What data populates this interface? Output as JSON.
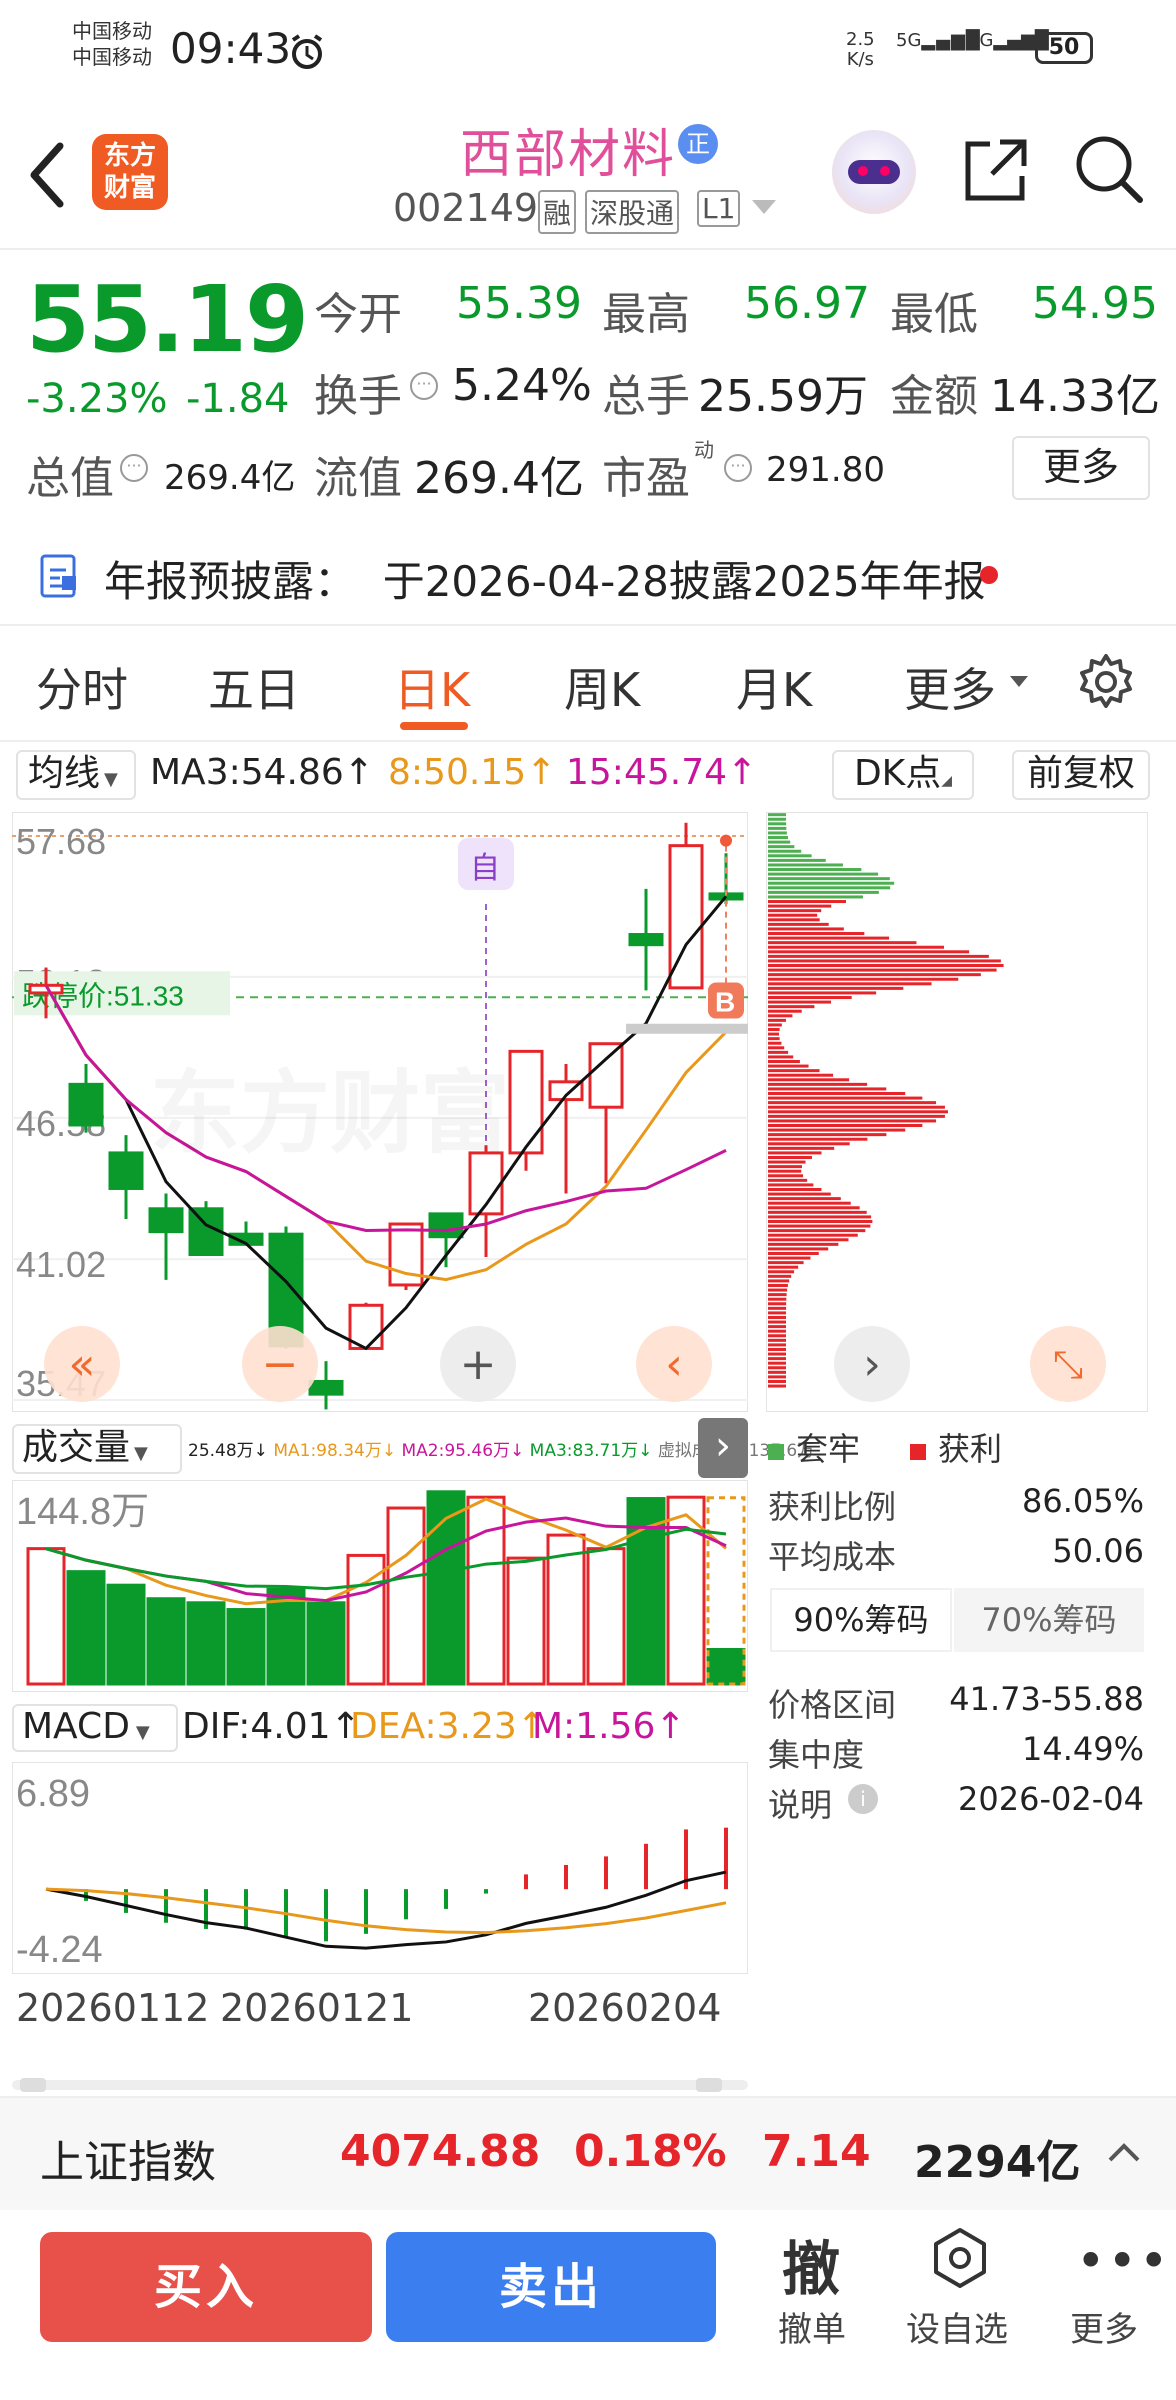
{
  "status_bar": {
    "carrier1": "中国移动",
    "carrier2": "中国移动",
    "time": "09:43",
    "net_speed_top": "2.5",
    "net_speed_bottom": "K/s",
    "sig1": "5G",
    "sig2": "4G",
    "battery": "50"
  },
  "header": {
    "logo_line1": "东方",
    "logo_line2": "财富",
    "stock_name": "西部材料",
    "badge": "正",
    "code": "002149",
    "tags": [
      "融",
      "深股通",
      "L1"
    ]
  },
  "quote": {
    "price": "55.19",
    "change_pct": "-3.23%",
    "change_amt": "-1.84",
    "row1": [
      {
        "label": "今开",
        "value": "55.39"
      },
      {
        "label": "最高",
        "value": "56.97"
      },
      {
        "label": "最低",
        "value": "54.95"
      }
    ],
    "row2": [
      {
        "label": "换手",
        "value": "5.24%"
      },
      {
        "label": "总手",
        "value": "25.59万"
      },
      {
        "label": "金额",
        "value": "14.33亿"
      }
    ],
    "total_value_label": "总值",
    "total_value": "269.4亿",
    "float_label": "流值",
    "float_value": "269.4亿",
    "pe_label": "市盈",
    "pe_sup": "动",
    "pe_value": "291.80",
    "more_btn": "更多"
  },
  "notice": {
    "text": "年报预披露：  于2026-04-28披露2025年年报"
  },
  "tabs": [
    "分时",
    "五日",
    "日K",
    "周K",
    "月K",
    "更多"
  ],
  "active_tab": "日K",
  "kline": {
    "ma_dropdown": "均线",
    "ma3": "MA3:54.86",
    "ma3_arrow": "↑",
    "ma8": "8:50.15",
    "ma8_arrow": "↑",
    "ma15": "15:45.74",
    "ma15_arrow": "↑",
    "dk_btn": "DK点",
    "fq_btn": "前复权",
    "yticks": [
      "57.68",
      "52.13",
      "46.58",
      "41.02",
      "35.47"
    ],
    "limit_down": "跌停价:51.33",
    "self_tag": "自",
    "buy_tag": "B",
    "watermark": "东方财富"
  },
  "volume": {
    "dropdown": "成交量",
    "info": [
      {
        "t": "25.48万↓",
        "c": "#222"
      },
      {
        "t": "MA1:98.34万↓",
        "c": "#e8981b"
      },
      {
        "t": "MA2:95.46万↓",
        "c": "#c7169b"
      },
      {
        "t": "MA3:83.71万↓",
        "c": "#0a9a2c"
      },
      {
        "t": "虚拟成交量:137.6万",
        "c": "#777"
      }
    ],
    "ytick": "144.8万"
  },
  "macd": {
    "dropdown": "MACD",
    "dif": "DIF:4.01↑",
    "dea": "DEA:3.23↑",
    "m": "M:1.56↑",
    "ytop": "6.89",
    "ybot": "-4.24"
  },
  "dates": [
    "20260112",
    "20260121",
    "20260204"
  ],
  "chip": {
    "legend_trap": "套牢",
    "legend_profit": "获利",
    "profit_ratio_label": "获利比例",
    "profit_ratio": "86.05%",
    "avg_cost_label": "平均成本",
    "avg_cost": "50.06",
    "tab90": "90%筹码",
    "tab70": "70%筹码",
    "range_label": "价格区间",
    "range": "41.73-55.88",
    "conc_label": "集中度",
    "conc": "14.49%",
    "note_label": "说明",
    "note": "2026-02-04"
  },
  "index_bar": {
    "name": "上证指数",
    "price": "4074.88",
    "pct": "0.18%",
    "chg": "7.14",
    "amount": "2294亿"
  },
  "bottom": {
    "buy": "买入",
    "sell": "卖出",
    "cancel_glyph": "撤",
    "cancel": "撤单",
    "watch": "设自选",
    "more": "更多"
  },
  "chart_data": {
    "type": "candlestick",
    "title": "",
    "xlabel": "",
    "ylabel": "",
    "x": [
      "20260112",
      "",
      "",
      "",
      "",
      "",
      "",
      "20260121",
      "",
      "",
      "",
      "",
      "",
      "",
      "",
      "",
      "",
      "20260204"
    ],
    "ohlc": [
      [
        51.5,
        52.5,
        50.5,
        51.8
      ],
      [
        47.9,
        48.7,
        46.0,
        46.3
      ],
      [
        45.2,
        45.9,
        42.6,
        43.8
      ],
      [
        43.0,
        43.6,
        40.2,
        42.1
      ],
      [
        43.0,
        43.3,
        41.5,
        41.2
      ],
      [
        42.0,
        42.5,
        41.6,
        41.6
      ],
      [
        42.0,
        42.3,
        37.5,
        37.6
      ],
      [
        36.2,
        37.0,
        35.1,
        35.7
      ],
      [
        37.5,
        39.3,
        37.5,
        39.2
      ],
      [
        40.0,
        42.4,
        39.8,
        42.4
      ],
      [
        42.8,
        42.8,
        40.7,
        41.9
      ],
      [
        42.8,
        45.5,
        41.1,
        45.2
      ],
      [
        45.2,
        49.2,
        44.5,
        49.2
      ],
      [
        47.3,
        48.7,
        43.6,
        48.0
      ],
      [
        47.0,
        49.5,
        44.0,
        49.5
      ],
      [
        53.8,
        55.6,
        51.6,
        53.4
      ],
      [
        51.7,
        58.2,
        51.7,
        57.3
      ],
      [
        55.4,
        57.0,
        55.0,
        55.2
      ]
    ],
    "volume_wan": [
      100,
      83,
      73,
      63,
      60,
      55,
      70,
      60,
      95,
      130,
      142,
      138,
      93,
      110,
      100,
      137,
      138,
      25.5
    ],
    "ylim": [
      35.47,
      57.68
    ],
    "volume_ylim": [
      0,
      144.8
    ],
    "series": [
      {
        "name": "MA3",
        "last": 54.86
      },
      {
        "name": "MA8",
        "last": 50.15
      },
      {
        "name": "MA15",
        "last": 45.74
      }
    ],
    "macd": {
      "ylim": [
        -4.24,
        6.89
      ],
      "dif": 4.01,
      "dea": 3.23,
      "m": 1.56
    }
  }
}
